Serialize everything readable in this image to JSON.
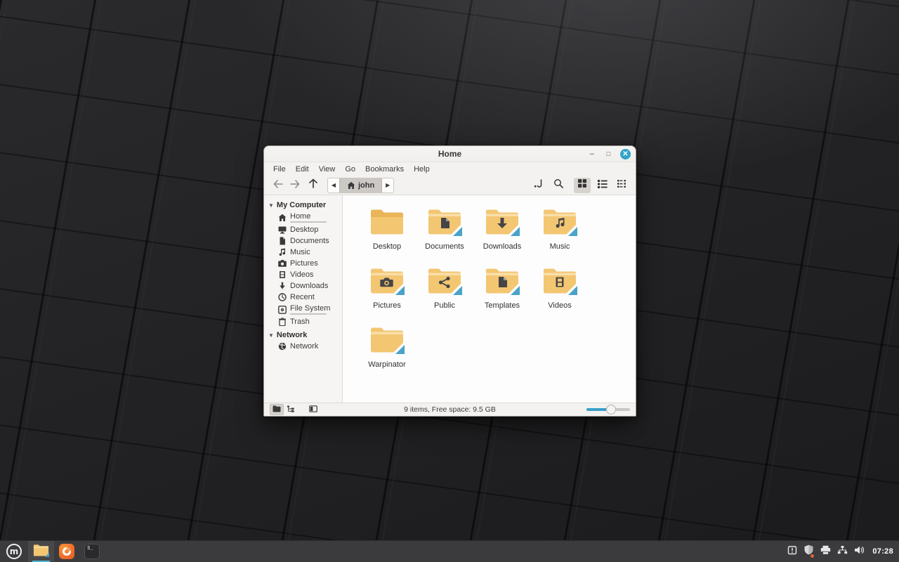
{
  "window": {
    "title": "Home",
    "controls": {
      "minimize": "–",
      "maximize": "□",
      "close": "✕"
    }
  },
  "menubar": {
    "items": [
      "File",
      "Edit",
      "View",
      "Go",
      "Bookmarks",
      "Help"
    ]
  },
  "toolbar": {
    "breadcrumb_current": "john",
    "icons": [
      "back-icon",
      "forward-icon",
      "up-icon",
      "location-entry-icon",
      "search-icon",
      "grid-view-icon",
      "list-view-icon",
      "compact-view-icon"
    ],
    "active_view": "grid"
  },
  "sidebar": {
    "sections": [
      {
        "label": "My Computer",
        "items": [
          {
            "label": "Home",
            "icon": "home-icon",
            "selected": true,
            "has_usage_bar": true
          },
          {
            "label": "Desktop",
            "icon": "desktop-icon"
          },
          {
            "label": "Documents",
            "icon": "documents-icon"
          },
          {
            "label": "Music",
            "icon": "music-icon"
          },
          {
            "label": "Pictures",
            "icon": "pictures-icon"
          },
          {
            "label": "Videos",
            "icon": "videos-icon"
          },
          {
            "label": "Downloads",
            "icon": "downloads-icon"
          },
          {
            "label": "Recent",
            "icon": "recent-icon"
          },
          {
            "label": "File System",
            "icon": "filesystem-icon",
            "has_usage_bar": true
          },
          {
            "label": "Trash",
            "icon": "trash-icon"
          }
        ]
      },
      {
        "label": "Network",
        "items": [
          {
            "label": "Network",
            "icon": "network-icon"
          }
        ]
      }
    ]
  },
  "files": {
    "items": [
      {
        "label": "Desktop",
        "icon": "folder-desktop-icon",
        "emblem": "none",
        "style": "plain"
      },
      {
        "label": "Documents",
        "icon": "folder-documents-icon",
        "emblem": "document"
      },
      {
        "label": "Downloads",
        "icon": "folder-downloads-icon",
        "emblem": "down-arrow"
      },
      {
        "label": "Music",
        "icon": "folder-music-icon",
        "emblem": "music-note"
      },
      {
        "label": "Pictures",
        "icon": "folder-pictures-icon",
        "emblem": "camera"
      },
      {
        "label": "Public",
        "icon": "folder-public-icon",
        "emblem": "share"
      },
      {
        "label": "Templates",
        "icon": "folder-templates-icon",
        "emblem": "document"
      },
      {
        "label": "Videos",
        "icon": "folder-videos-icon",
        "emblem": "film"
      },
      {
        "label": "Warpinator",
        "icon": "folder-warpinator-icon",
        "emblem": "none"
      }
    ]
  },
  "statusbar": {
    "status_text": "9 items, Free space: 9.5 GB",
    "buttons": [
      "places-toggle-icon",
      "treeview-toggle-icon",
      "sidebar-toggle-icon"
    ]
  },
  "taskbar": {
    "launchers": [
      {
        "name": "menu",
        "icon": "mint-menu-icon",
        "logo_letter": "m"
      },
      {
        "name": "files",
        "icon": "files-icon",
        "active": true
      },
      {
        "name": "firefox",
        "icon": "firefox-icon"
      },
      {
        "name": "terminal",
        "icon": "terminal-icon",
        "glyph": "$_"
      }
    ],
    "tray": [
      "update-manager-icon",
      "shield-icon",
      "printer-icon",
      "network-tray-icon",
      "volume-icon"
    ],
    "clock": "07:28"
  },
  "colors": {
    "accent": "#32a3c9",
    "folder_body": "#f2c36d",
    "folder_tab": "#e5ad55",
    "emblem": "#4a4a4a",
    "corner_stripe": "#4aa3c8",
    "usage_bar": "#63a8a3",
    "taskbar_bg": "#3b3b3d"
  }
}
